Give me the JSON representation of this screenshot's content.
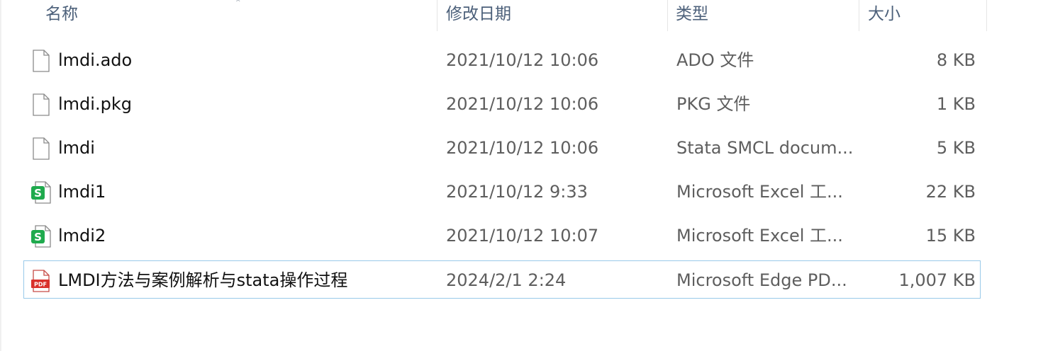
{
  "header": {
    "columns": {
      "name": "名称",
      "date": "修改日期",
      "type": "类型",
      "size": "大小"
    },
    "sort_glyph": "^"
  },
  "files": [
    {
      "name": "lmdi.ado",
      "date": "2021/10/12 10:06",
      "type": "ADO 文件",
      "size": "8 KB",
      "icon": "blank-file-icon"
    },
    {
      "name": "lmdi.pkg",
      "date": "2021/10/12 10:06",
      "type": "PKG 文件",
      "size": "1 KB",
      "icon": "blank-file-icon"
    },
    {
      "name": "lmdi",
      "date": "2021/10/12 10:06",
      "type": "Stata SMCL docum...",
      "size": "5 KB",
      "icon": "blank-file-icon"
    },
    {
      "name": "lmdi1",
      "date": "2021/10/12 9:33",
      "type": "Microsoft Excel 工...",
      "size": "22 KB",
      "icon": "spreadsheet-icon"
    },
    {
      "name": "lmdi2",
      "date": "2021/10/12 10:07",
      "type": "Microsoft Excel 工...",
      "size": "15 KB",
      "icon": "spreadsheet-icon"
    },
    {
      "name": "LMDI方法与案例解析与stata操作过程",
      "date": "2024/2/1 2:24",
      "type": "Microsoft Edge PD...",
      "size": "1,007 KB",
      "icon": "pdf-icon",
      "selected": true
    }
  ],
  "colors": {
    "header_text": "#4c607a",
    "selection_border": "#99c9e9",
    "spreadsheet_green": "#1faa4d",
    "pdf_red": "#d9302b"
  },
  "icon_labels": {
    "spreadsheet": "S",
    "pdf": "PDF"
  }
}
